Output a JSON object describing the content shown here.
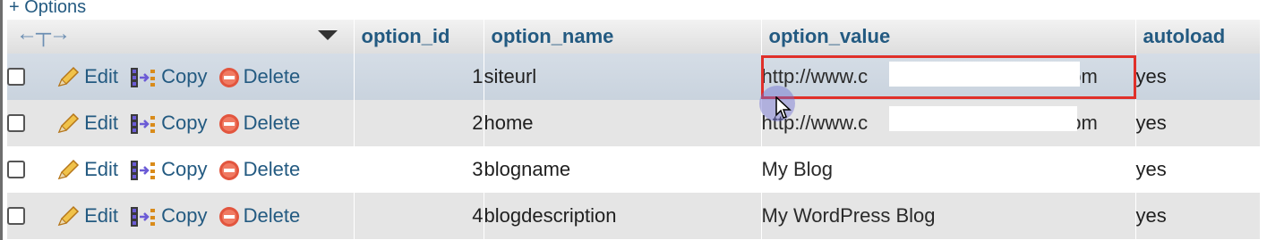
{
  "options_link": "+ Options",
  "header": {
    "option_id": "option_id",
    "option_name": "option_name",
    "option_value": "option_value",
    "autoload": "autoload"
  },
  "actions": {
    "edit": "Edit",
    "copy": "Copy",
    "delete": "Delete"
  },
  "rows": [
    {
      "id": "1",
      "name": "siteurl",
      "value_prefix": "http://www.c",
      "value_suffix": ".com",
      "autoload": "yes"
    },
    {
      "id": "2",
      "name": "home",
      "value_prefix": "http://www.c",
      "value_suffix": ".com",
      "autoload": "yes"
    },
    {
      "id": "3",
      "name": "blogname",
      "value": "My Blog",
      "autoload": "yes"
    },
    {
      "id": "4",
      "name": "blogdescription",
      "value": "My WordPress Blog",
      "autoload": "yes"
    }
  ],
  "colors": {
    "link": "#235a81",
    "highlight": "#e0302a",
    "row_alt": "#e5e5e5",
    "row_hover": "#c9d3de"
  },
  "icons": [
    "left-right-arrow-icon",
    "sort-caret-icon",
    "pencil-icon",
    "copy-icon",
    "delete-icon",
    "mouse-cursor-icon"
  ]
}
